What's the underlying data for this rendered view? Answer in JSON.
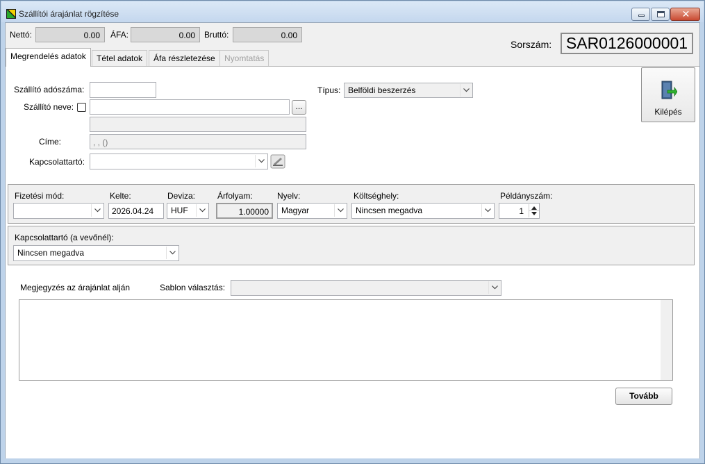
{
  "window": {
    "title": "Szállítói árajánlat rögzítése"
  },
  "totals": {
    "net_label": "Nettó:",
    "net_value": "0.00",
    "vat_label": "ÁFA:",
    "vat_value": "0.00",
    "gross_label": "Bruttó:",
    "gross_value": "0.00",
    "serial_label": "Sorszám:",
    "serial_value": "SAR0126000001"
  },
  "tabs": [
    {
      "label": "Megrendelés adatok",
      "active": true
    },
    {
      "label": "Tétel adatok"
    },
    {
      "label": "Áfa részletezése"
    },
    {
      "label": "Nyomtatás",
      "disabled": true
    }
  ],
  "supplier": {
    "tax_label": "Szállító adószáma:",
    "tax_value": "",
    "name_label": "Szállító neve:",
    "name_value": "",
    "name_extra": "",
    "browse_label": "...",
    "address_label": "Címe:",
    "address_value": ", , ()",
    "contact_label": "Kapcsolattartó:",
    "contact_value": ""
  },
  "type": {
    "label": "Típus:",
    "value": "Belföldi beszerzés"
  },
  "exit_button": {
    "label": "Kilépés"
  },
  "payment": {
    "method_label": "Fizetési mód:",
    "method_value": "",
    "date_label": "Kelte:",
    "date_value": "2026.04.24",
    "currency_label": "Deviza:",
    "currency_value": "HUF",
    "rate_label": "Árfolyam:",
    "rate_value": "1.00000",
    "language_label": "Nyelv:",
    "language_value": "Magyar",
    "cost_center_label": "Költséghely:",
    "cost_center_value": "Nincsen megadva",
    "copies_label": "Példányszám:",
    "copies_value": "1"
  },
  "buyer_contact": {
    "label": "Kapcsolattartó (a vevőnél):",
    "value": "Nincsen megadva"
  },
  "note": {
    "label": "Megjegyzés az árajánlat alján",
    "template_label": "Sablon választás:",
    "template_value": "",
    "text": ""
  },
  "next_button": {
    "label": "Tovább"
  },
  "icons": [
    "app-icon",
    "exit-door-icon",
    "contact-card-icon",
    "dropdown-arrow-icon"
  ]
}
